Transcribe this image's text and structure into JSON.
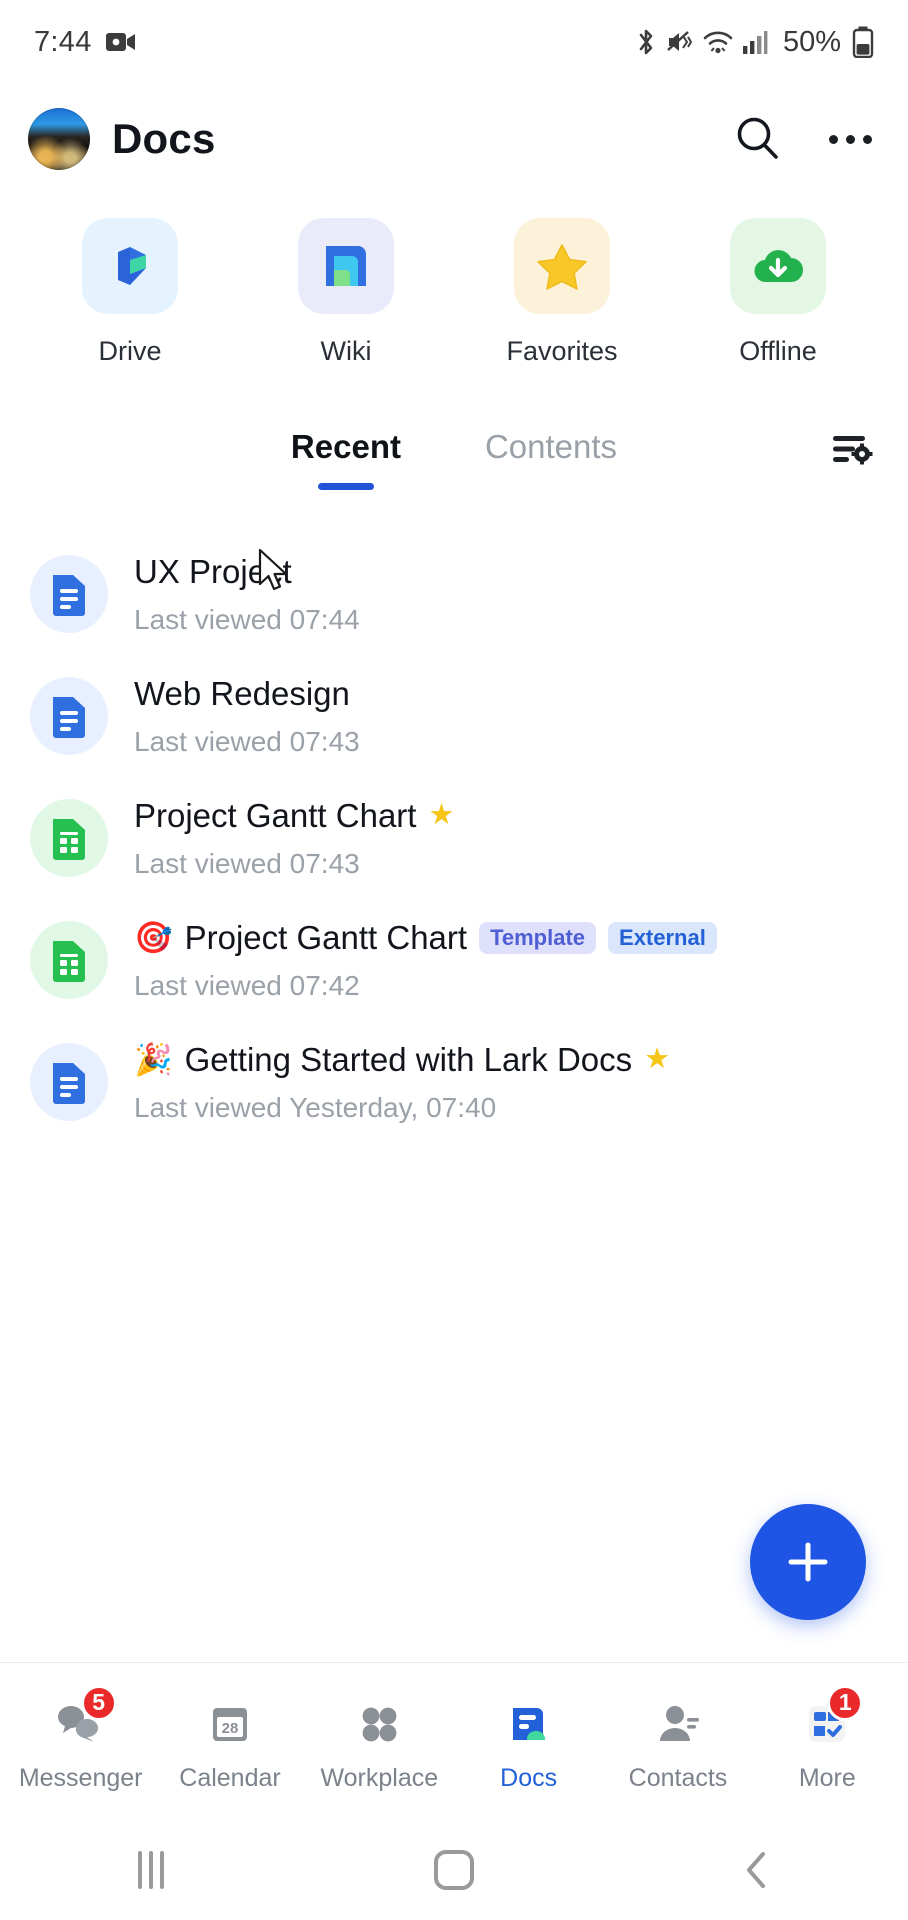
{
  "status_bar": {
    "time": "7:44",
    "battery_percent": "50%",
    "icons": [
      "screen-record-icon",
      "bluetooth-icon",
      "mute-vibrate-icon",
      "wifi-icon",
      "cellular-signal-icon",
      "battery-icon"
    ]
  },
  "app_bar": {
    "title": "Docs",
    "avatar": "user-avatar",
    "search_icon": "search-icon",
    "more_icon": "more-options-icon"
  },
  "shortcuts": [
    {
      "label": "Drive",
      "icon": "drive-icon",
      "tile_color": "#e4f3fd"
    },
    {
      "label": "Wiki",
      "icon": "wiki-icon",
      "tile_color": "#e9ebfa"
    },
    {
      "label": "Favorites",
      "icon": "star-icon",
      "tile_color": "#fcf1d9"
    },
    {
      "label": "Offline",
      "icon": "offline-cloud-icon",
      "tile_color": "#e3f7e4"
    }
  ],
  "tabs": {
    "items": [
      {
        "label": "Recent",
        "active": true
      },
      {
        "label": "Contents",
        "active": false
      }
    ],
    "filter_icon": "filter-settings-icon"
  },
  "documents": [
    {
      "emoji": "",
      "title": "UX Project",
      "subtitle": "Last viewed 07:44",
      "icon": "doc-icon",
      "icon_type": "doc",
      "starred": false,
      "tags": []
    },
    {
      "emoji": "",
      "title": "Web Redesign",
      "subtitle": "Last viewed 07:43",
      "icon": "doc-icon",
      "icon_type": "doc",
      "starred": true,
      "tags": []
    },
    {
      "emoji": "",
      "title": "Project Gantt Chart",
      "subtitle": "Last viewed 07:43",
      "icon": "sheet-icon",
      "icon_type": "sheet",
      "starred": true,
      "tags": []
    },
    {
      "emoji": "🎯",
      "title": "Project Gantt Chart",
      "subtitle": "Last viewed 07:42",
      "icon": "sheet-icon",
      "icon_type": "sheet",
      "starred": false,
      "tags": [
        "Template",
        "External"
      ]
    },
    {
      "emoji": "🎉",
      "title": "Getting Started with Lark Docs",
      "subtitle": "Last viewed Yesterday, 07:40",
      "icon": "doc-icon",
      "icon_type": "doc",
      "starred": true,
      "tags": []
    }
  ],
  "fab": {
    "icon": "plus-icon",
    "color": "#1f55e5"
  },
  "bottom_nav": [
    {
      "label": "Messenger",
      "icon": "messenger-icon",
      "badge": "5",
      "active": false
    },
    {
      "label": "Calendar",
      "icon": "calendar-icon",
      "badge": "",
      "day": "28",
      "active": false
    },
    {
      "label": "Workplace",
      "icon": "workplace-grid-icon",
      "badge": "",
      "active": false
    },
    {
      "label": "Docs",
      "icon": "docs-icon",
      "badge": "",
      "active": true
    },
    {
      "label": "Contacts",
      "icon": "contacts-icon",
      "badge": "",
      "active": false
    },
    {
      "label": "More",
      "icon": "more-apps-icon",
      "badge": "1",
      "active": false
    }
  ],
  "system_nav": {
    "recents": "recents-icon",
    "home": "home-icon",
    "back": "back-icon"
  }
}
